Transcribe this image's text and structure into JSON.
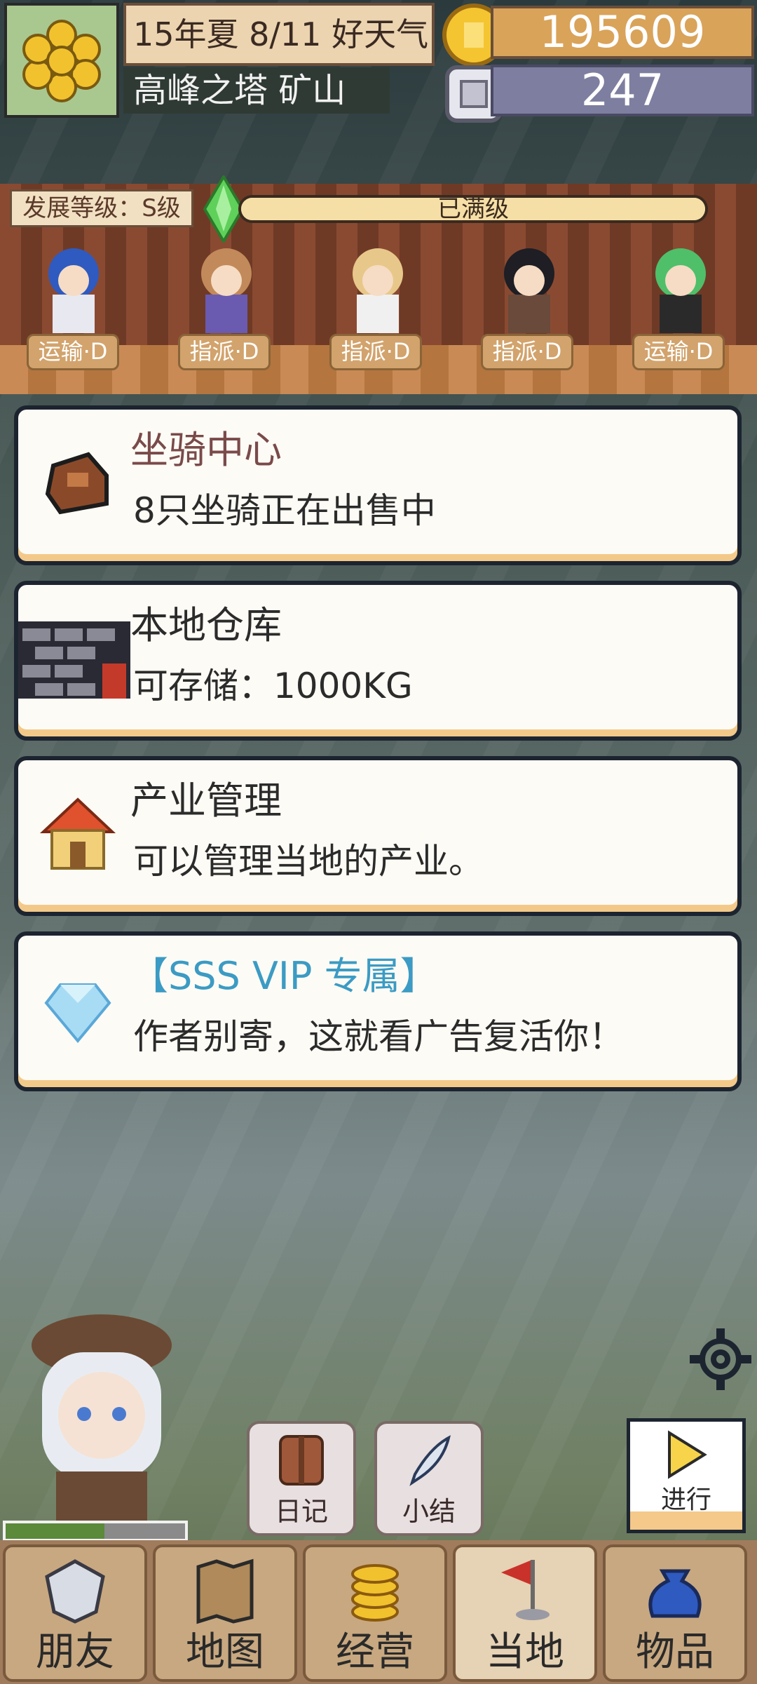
{
  "header": {
    "date": "15年夏 8/11 好天气",
    "location": "高峰之塔 矿山",
    "gold": "195609",
    "silver": "247"
  },
  "development": {
    "label": "发展等级：S级",
    "status": "已满级",
    "progress_fraction": 1.0
  },
  "workers": [
    {
      "role": "运输·D"
    },
    {
      "role": "指派·D"
    },
    {
      "role": "指派·D"
    },
    {
      "role": "指派·D"
    },
    {
      "role": "运输·D"
    }
  ],
  "cards": [
    {
      "title": "坐骑中心",
      "desc": "8只坐骑正在出售中",
      "title_color": "#7a4a4a",
      "icon": "horse-saddle-icon"
    },
    {
      "title": "本地仓库",
      "desc": "可存储：1000KG",
      "title_color": "#2b2b2b",
      "icon": "warehouse-icon"
    },
    {
      "title": "产业管理",
      "desc": "可以管理当地的产业。",
      "title_color": "#2b2b2b",
      "icon": "house-icon"
    },
    {
      "title": "【SSS VIP 专属】",
      "desc": "作者别寄，这就看广告复活你！",
      "title_color": "#3b9bc4",
      "icon": "diamond-icon"
    }
  ],
  "hero": {
    "hp_fraction": 0.55
  },
  "actions": {
    "diary": "日记",
    "summary": "小结",
    "proceed": "进行"
  },
  "nav": [
    {
      "label": "朋友",
      "icon": "shield-icon"
    },
    {
      "label": "地图",
      "icon": "map-icon"
    },
    {
      "label": "经营",
      "icon": "coin-stack-icon"
    },
    {
      "label": "当地",
      "icon": "flag-icon",
      "active": true
    },
    {
      "label": "物品",
      "icon": "bag-icon"
    }
  ]
}
